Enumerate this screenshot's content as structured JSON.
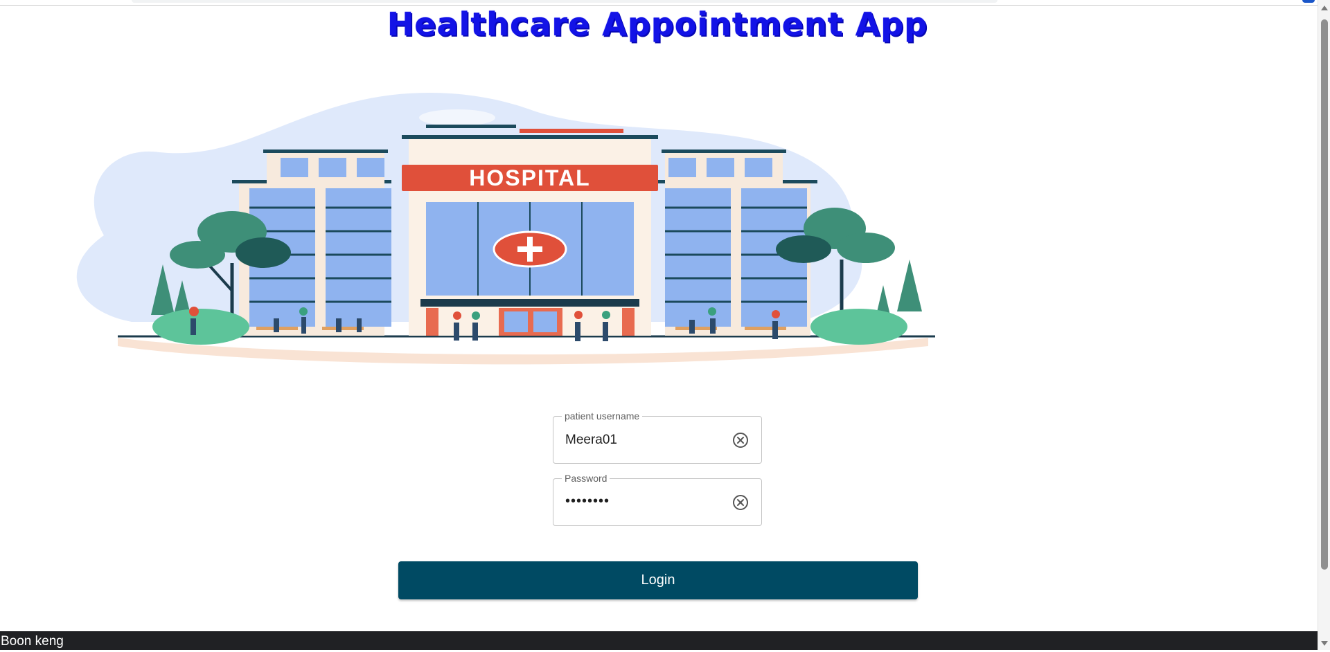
{
  "app": {
    "title": "Healthcare Appointment App"
  },
  "hero": {
    "sign": "HOSPITAL"
  },
  "form": {
    "username": {
      "label": "patient username",
      "value": "Meera01"
    },
    "password": {
      "label": "Password",
      "value": "••••••••"
    },
    "login_label": "Login"
  },
  "footer": {
    "text": "Boon keng"
  },
  "colors": {
    "title": "#1313e6",
    "button": "#004a63",
    "footer": "#202124",
    "sign": "#e0503a"
  }
}
